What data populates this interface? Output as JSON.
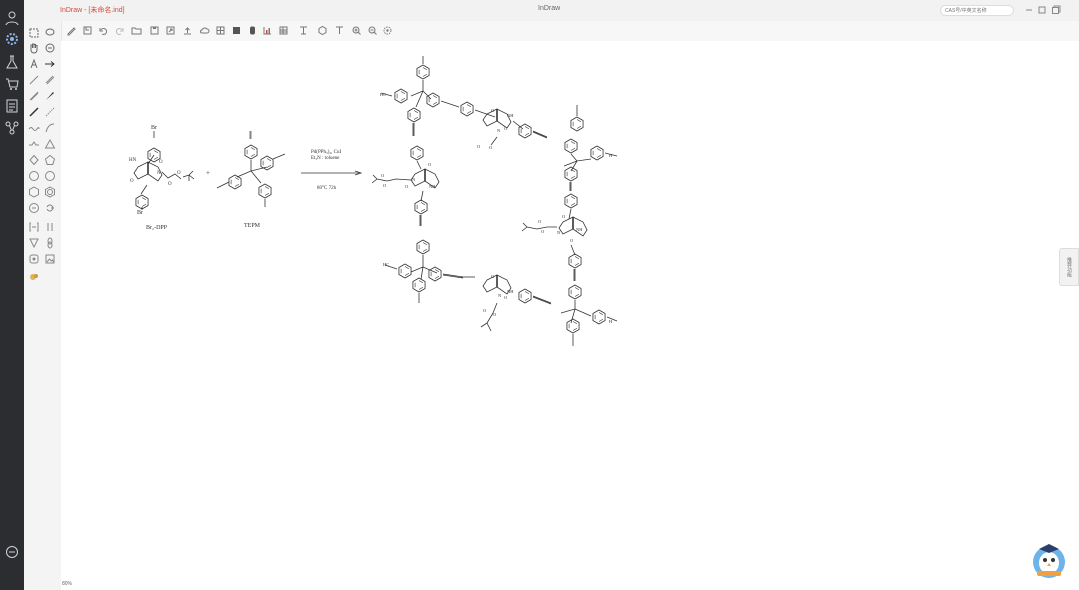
{
  "app": {
    "title": "InDraw - [未命名.ind]",
    "center_title": "InDraw",
    "search_placeholder": "CAS号/中英文名称",
    "side_tab_label": "推荐功能",
    "zoom": "80%"
  },
  "scheme": {
    "reactant1_label": "Br₂-DPP",
    "reactant2_label": "TEPM",
    "plus": "+",
    "conditions_line1": "Pd(PPh₃)₄, CuI",
    "conditions_line2": "Et₃N : toluene",
    "conditions_line3": "80°C 72h"
  },
  "colors": {
    "left_bar": "#2b2d30",
    "title_accent": "#d24b3a",
    "canvas": "#ffffff",
    "bond": "#333333"
  },
  "icons": {
    "left_bar": [
      "user-icon",
      "settings-icon",
      "flask-icon",
      "cart-icon",
      "document-icon",
      "molecule-icon",
      "chat-icon"
    ],
    "toolbar": [
      "new-icon",
      "open-icon",
      "undo-icon",
      "redo-icon",
      "folder-icon",
      "save-icon",
      "export-icon",
      "upload-icon",
      "cloud-icon",
      "grid-icon",
      "select-icon",
      "color-icon",
      "chart-icon",
      "table-icon",
      "structure-icon",
      "ring-icon",
      "text-icon",
      "zoom-in-icon",
      "zoom-out-icon",
      "zoom-fit-icon",
      "settings-icon"
    ],
    "palette": [
      "rect-select-icon",
      "lasso-icon",
      "hand-icon",
      "eraser-icon",
      "text-tool-icon",
      "arrow-tool-icon",
      "bond-single-icon",
      "bond-double-icon",
      "bond-wedge-icon",
      "bond-hash-icon",
      "line-icon",
      "chain-icon",
      "wave-icon",
      "curve-icon",
      "benzene-icon",
      "triangle-icon",
      "hexagon-icon",
      "pentagon-icon",
      "circle-icon",
      "cyclohexane-icon",
      "cyclopentane-icon",
      "cycloheptane-icon",
      "bracket-icon",
      "symbol-icon",
      "table-tool-icon",
      "orbital-icon",
      "flask-tool-icon",
      "template-icon",
      "atom-icon"
    ]
  }
}
